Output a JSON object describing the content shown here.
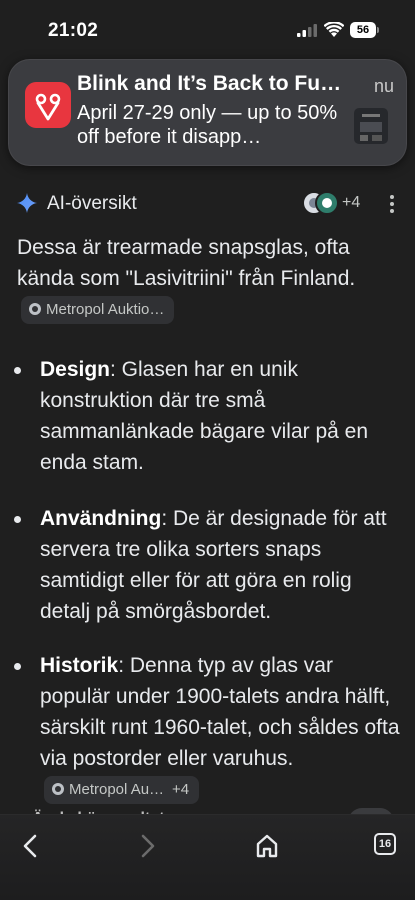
{
  "status_bar": {
    "time": "21:02",
    "battery_level": "56"
  },
  "notification": {
    "app_icon": "vivino-v-icon",
    "title": "Blink and It’s Back to Fu…",
    "body": "April 27-29 only — up to 50% off before it disapp…",
    "time": "nu"
  },
  "ai_overview": {
    "icon": "sparkle-icon",
    "title": "AI-översikt",
    "source_count": "+4"
  },
  "content": {
    "intro": "Dessa är trearmade snapsglas, ofta kända som \"Lasivitriini\" från Finland.",
    "intro_chip": "Metropol Auktio…",
    "bullets": [
      {
        "term": "Design",
        "text": ": Glasen har en unik konstruktion där tre små sammanlänkade bägare vilar på en enda stam."
      },
      {
        "term": "Användning",
        "text": ": De är designade för att servera tre olika sorters snaps samtidigt eller för att göra en rolig detalj på smörgåsbordet."
      },
      {
        "term": "Historik",
        "text": ": Denna typ av glas var populär under 1900-talets andra hälft, särskilt runt 1960-talet, och såldes ofta via postorder eller varuhus.",
        "chip": "Metropol Au…",
        "chip_extra": "+4"
      }
    ],
    "peek_text": "Är de här resultaten"
  },
  "toolbar": {
    "tab_count": "16"
  },
  "colors": {
    "background": "#1f1f1f",
    "text": "#e8eaed",
    "accent_sparkle": "#4c8df6",
    "notif_app": "#e8363f"
  }
}
